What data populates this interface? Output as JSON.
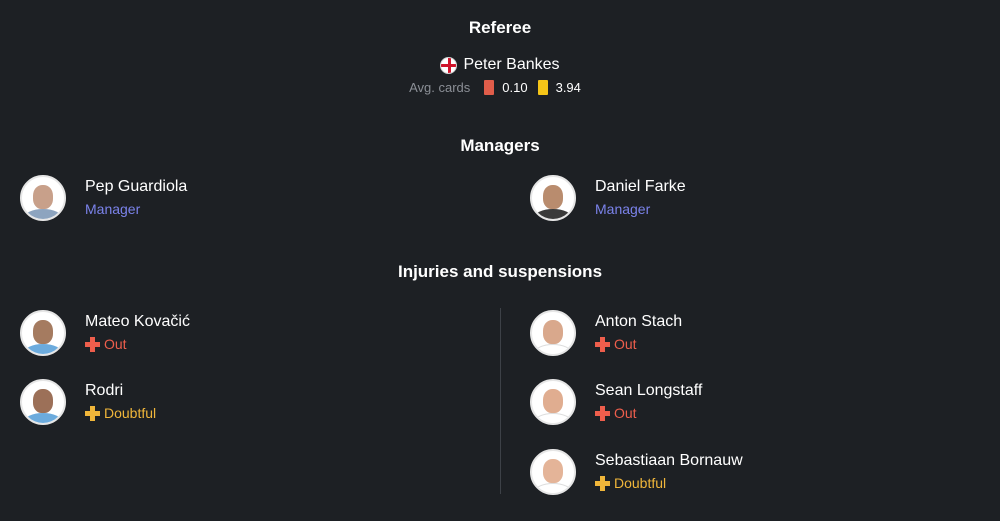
{
  "referee": {
    "title": "Referee",
    "name": "Peter Bankes",
    "flag_icon": "england-flag-icon",
    "avg_cards_label": "Avg. cards",
    "red_avg": "0.10",
    "yellow_avg": "3.94",
    "red_color": "#e05d4a",
    "yellow_color": "#f5c518"
  },
  "managers": {
    "title": "Managers",
    "home": {
      "name": "Pep Guardiola",
      "role": "Manager"
    },
    "away": {
      "name": "Daniel Farke",
      "role": "Manager"
    }
  },
  "injuries": {
    "title": "Injuries and suspensions",
    "home": [
      {
        "name": "Mateo Kovačić",
        "status": "Out"
      },
      {
        "name": "Rodri",
        "status": "Doubtful"
      }
    ],
    "away": [
      {
        "name": "Anton Stach",
        "status": "Out"
      },
      {
        "name": "Sean Longstaff",
        "status": "Out"
      },
      {
        "name": "Sebastiaan Bornauw",
        "status": "Doubtful"
      }
    ]
  },
  "colors": {
    "background": "#1d2024",
    "role": "#7b83eb",
    "out": "#ee5e4c",
    "doubtful": "#f0b63a"
  }
}
